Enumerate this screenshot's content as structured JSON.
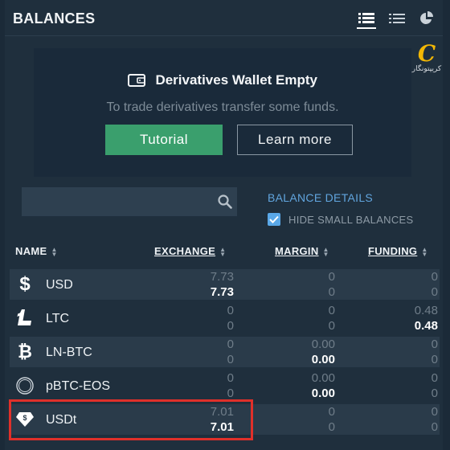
{
  "header": {
    "title": "BALANCES"
  },
  "empty_state": {
    "title": "Derivatives Wallet Empty",
    "subtitle": "To trade derivatives transfer some funds.",
    "tutorial_label": "Tutorial",
    "learn_more_label": "Learn more"
  },
  "search": {
    "placeholder": ""
  },
  "balance_details_label": "BALANCE DETAILS",
  "hide_small": {
    "label": "HIDE SMALL BALANCES",
    "checked": true
  },
  "columns": {
    "name": "NAME",
    "exchange": "EXCHANGE",
    "margin": "MARGIN",
    "funding": "FUNDING"
  },
  "rows": [
    {
      "name": "USD",
      "icon": "dollar-icon",
      "exchange": {
        "top": "7.73",
        "bottom": "7.73",
        "bottom_bold": true
      },
      "margin": {
        "top": "0",
        "bottom": "0",
        "bottom_bold": false
      },
      "funding": {
        "top": "0",
        "bottom": "0",
        "bottom_bold": false
      }
    },
    {
      "name": "LTC",
      "icon": "litecoin-icon",
      "exchange": {
        "top": "0",
        "bottom": "0",
        "bottom_bold": false
      },
      "margin": {
        "top": "0",
        "bottom": "0",
        "bottom_bold": false
      },
      "funding": {
        "top": "0.48",
        "bottom": "0.48",
        "bottom_bold": true
      }
    },
    {
      "name": "LN-BTC",
      "icon": "bitcoin-icon",
      "exchange": {
        "top": "0",
        "bottom": "0",
        "bottom_bold": false
      },
      "margin": {
        "top": "0.00",
        "bottom": "0.00",
        "bottom_bold": true
      },
      "funding": {
        "top": "0",
        "bottom": "0",
        "bottom_bold": false
      }
    },
    {
      "name": "pBTC-EOS",
      "icon": "pbtc-eos-icon",
      "exchange": {
        "top": "0",
        "bottom": "0",
        "bottom_bold": false
      },
      "margin": {
        "top": "0.00",
        "bottom": "0.00",
        "bottom_bold": true
      },
      "funding": {
        "top": "0",
        "bottom": "0",
        "bottom_bold": false
      }
    },
    {
      "name": "USDt",
      "icon": "tether-icon",
      "exchange": {
        "top": "7.01",
        "bottom": "7.01",
        "bottom_bold": true
      },
      "margin": {
        "top": "0",
        "bottom": "0",
        "bottom_bold": false
      },
      "funding": {
        "top": "0",
        "bottom": "0",
        "bottom_bold": false
      }
    }
  ],
  "watermark": {
    "glyph": "C",
    "text": "کریپتونگار"
  },
  "colors": {
    "accent_green": "#3a9f6d",
    "link_blue": "#61a5de",
    "highlight_red": "#e0302a",
    "panel_bg": "#1f2f3d"
  }
}
